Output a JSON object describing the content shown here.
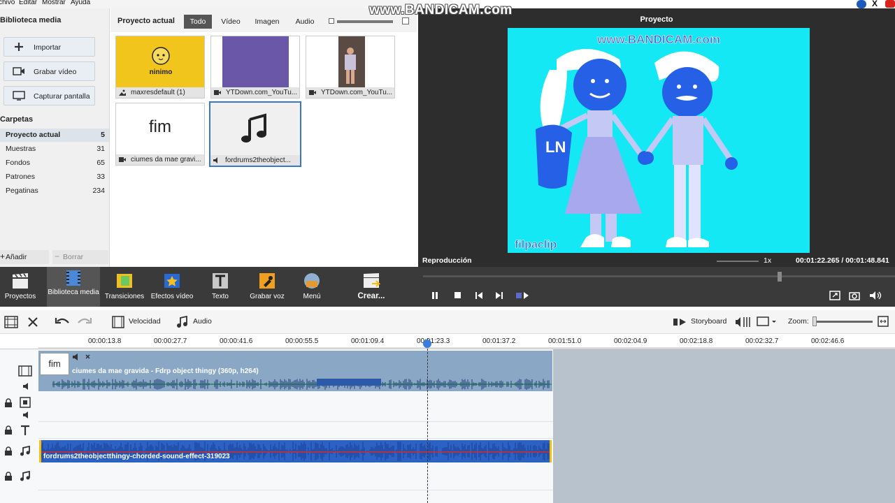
{
  "menu": [
    "chivo",
    "Editar",
    "Mostrar",
    "Ayuda"
  ],
  "watermark": "www.BANDICAM.com",
  "library": {
    "title": "Biblioteca media",
    "buttons": [
      {
        "label": "Importar",
        "icon": "plus-icon"
      },
      {
        "label": "Grabar vídeo",
        "icon": "video-camera-icon"
      },
      {
        "label": "Capturar pantalla",
        "icon": "monitor-icon"
      }
    ],
    "folders_title": "Carpetas",
    "folders": [
      {
        "name": "Proyecto actual",
        "count": "5",
        "selected": true
      },
      {
        "name": "Muestras",
        "count": "31"
      },
      {
        "name": "Fondos",
        "count": "65"
      },
      {
        "name": "Patrones",
        "count": "33"
      },
      {
        "name": "Pegatinas",
        "count": "234"
      }
    ],
    "add_label": "Añadir",
    "delete_label": "Borrar"
  },
  "media": {
    "title": "Proyecto actual",
    "filters": [
      "Todo",
      "Vídeo",
      "Imagen",
      "Audio"
    ],
    "active_filter": "Todo",
    "items": [
      {
        "caption": "maxresdefault (1)",
        "type": "image",
        "thumb_text": "ninimo",
        "thumb_color": "#f2c51c"
      },
      {
        "caption": "YTDown.com_YouTu...",
        "type": "video",
        "thumb_color": "#6b57a8"
      },
      {
        "caption": "YTDown.com_YouTu...",
        "type": "video",
        "thumb_color": "#d8d8d8"
      },
      {
        "caption": "ciumes da mae gravi...",
        "type": "video",
        "thumb_text": "fim",
        "thumb_color": "#ffffff"
      },
      {
        "caption": "fordrums2theobject...",
        "type": "audio",
        "thumb_icon": "music-note-icon",
        "thumb_color": "#f0f0f0",
        "selected": true
      }
    ]
  },
  "preview": {
    "title": "Proyecto",
    "playback_label": "Reproducción",
    "speed": "1x",
    "timecode": "00:01:22.265 / 00:01:48.841",
    "frame_bg": "#14e8f5",
    "frame_texts": [
      "www.BANDICAM.com",
      "LN",
      "filpaclip"
    ],
    "playhead_fraction": 0.756
  },
  "toolbar": {
    "items": [
      {
        "label": "Proyectos",
        "icon": "clapperboard-icon"
      },
      {
        "label": "Biblioteca media",
        "icon": "film-icon",
        "active": true
      },
      {
        "label": "Transiciones",
        "icon": "transitions-icon"
      },
      {
        "label": "Efectos vídeo",
        "icon": "star-icon"
      },
      {
        "label": "Texto",
        "icon": "text-icon"
      },
      {
        "label": "Grabar voz",
        "icon": "microphone-icon"
      },
      {
        "label": "Menú",
        "icon": "menu-disc-icon"
      },
      {
        "label": "Crear...",
        "icon": "create-icon"
      }
    ]
  },
  "timeline": {
    "speed_label": "Velocidad",
    "audio_label": "Audio",
    "storyboard_label": "Storyboard",
    "zoom_label": "Zoom:",
    "ruler": [
      "00:00:13.8",
      "00:00:27.7",
      "00:00:41.6",
      "00:00:55.5",
      "00:01:09.4",
      "00:01:23.3",
      "00:01:37.2",
      "00:01:51.0",
      "00:02:04.9",
      "00:02:18.8",
      "00:02:32.7",
      "00:02:46.6"
    ],
    "video_clip": {
      "title": "ciumes da mae gravida - Fdrp object thingy (360p, h264)",
      "thumb_text": "fim"
    },
    "audio_clip": {
      "title": "fordrums2theobjectthingy-chorded-sound-effect-319023"
    }
  },
  "colors": {
    "dark": "#3a3a3a",
    "clip_video": "#8aa8c6",
    "clip_audio": "#2b62c4",
    "accent": "#3a78c4"
  }
}
